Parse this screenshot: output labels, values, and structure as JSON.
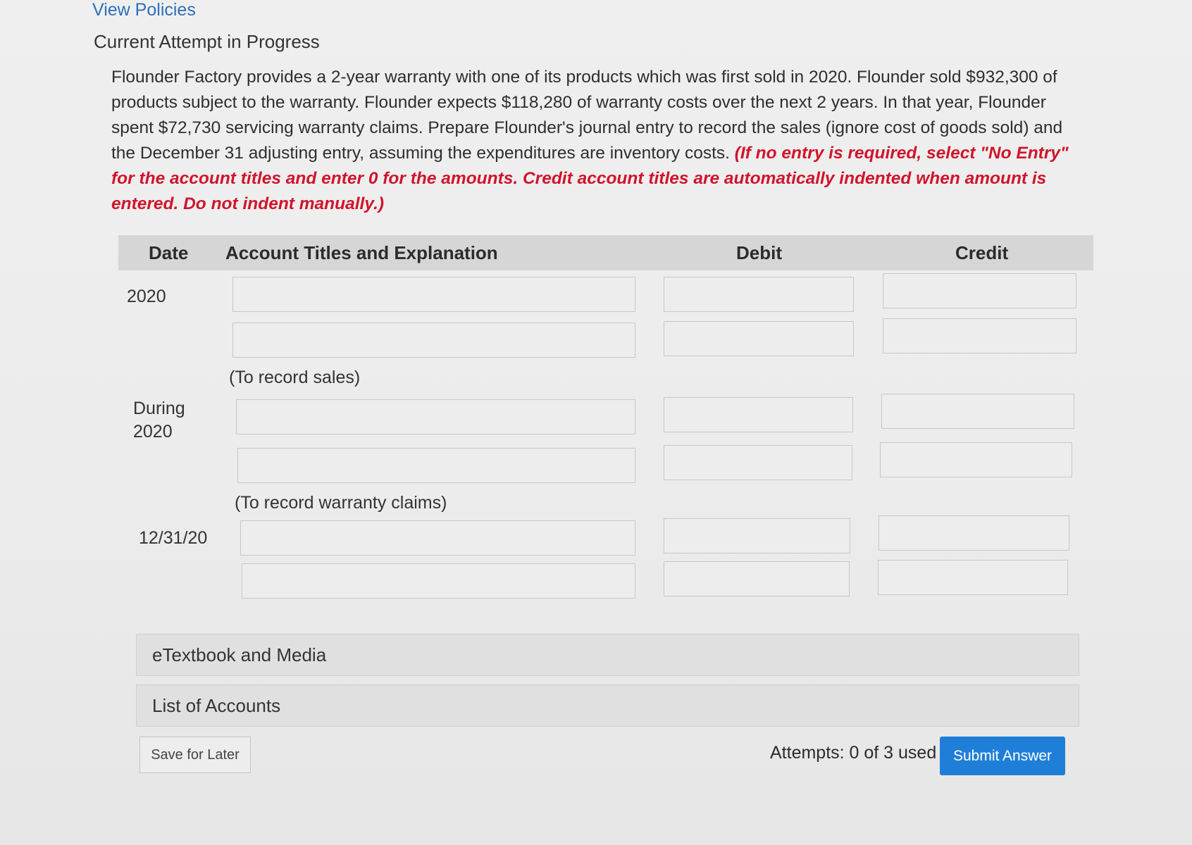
{
  "header": {
    "view_policies": "View Policies",
    "attempt_title": "Current Attempt in Progress"
  },
  "question": {
    "text": "Flounder Factory provides a 2-year warranty with one of its products which was first sold in 2020. Flounder sold $932,300 of products subject to the warranty. Flounder expects $118,280 of warranty costs over the next 2 years. In that year, Flounder spent $72,730 servicing warranty claims. Prepare Flounder's journal entry to record the sales (ignore cost of goods sold) and the December 31 adjusting entry, assuming the expenditures are inventory costs.",
    "instruction": "(If no entry is required, select \"No Entry\" for the account titles and enter 0 for the amounts. Credit account titles are automatically indented when amount is entered. Do not indent manually.)"
  },
  "table": {
    "headers": {
      "date": "Date",
      "account": "Account Titles and Explanation",
      "debit": "Debit",
      "credit": "Credit"
    },
    "entries": [
      {
        "date_line1": "2020",
        "date_line2": "",
        "note": "(To record sales)"
      },
      {
        "date_line1": "During",
        "date_line2": "2020",
        "note": "(To record warranty claims)"
      },
      {
        "date_line1": "12/31/20",
        "date_line2": "",
        "note": ""
      }
    ]
  },
  "sections": {
    "etextbook": "eTextbook and Media",
    "accounts": "List of Accounts"
  },
  "footer": {
    "save_label": "Save for Later",
    "attempts": "Attempts: 0 of 3 used",
    "submit_label": "Submit Answer"
  },
  "colors": {
    "link": "#2f6fba",
    "instruction": "#d0142b",
    "submit": "#1f7fd8",
    "header_bg": "#d6d6d6"
  }
}
